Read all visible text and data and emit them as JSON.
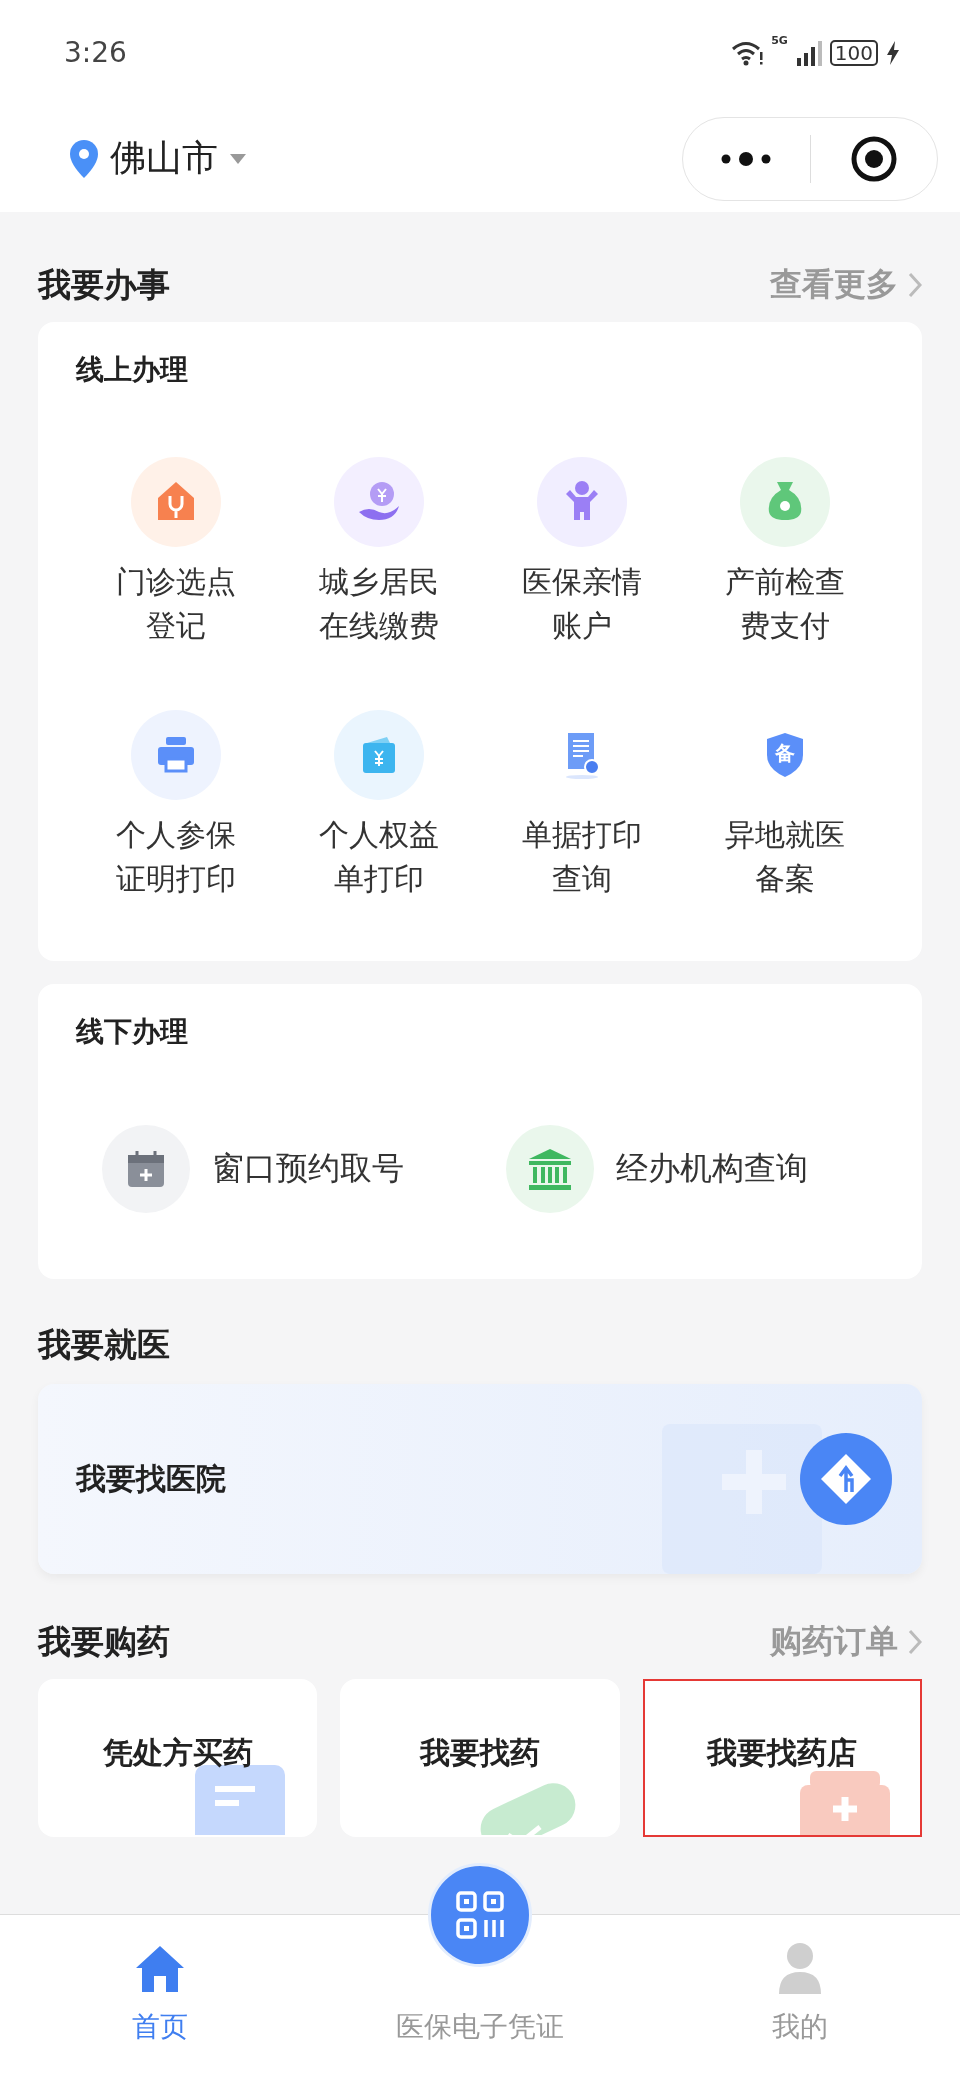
{
  "status_bar": {
    "time": "3:26",
    "network": "5G",
    "battery": "100"
  },
  "header": {
    "city": "佛山市"
  },
  "services": {
    "title": "我要办事",
    "more": "查看更多",
    "online": {
      "title": "线上办理",
      "items": [
        {
          "label": "门诊选点登记"
        },
        {
          "label": "城乡居民在线缴费"
        },
        {
          "label": "医保亲情账户"
        },
        {
          "label": "产前检查费支付"
        },
        {
          "label": "个人参保证明打印"
        },
        {
          "label": "个人权益单打印"
        },
        {
          "label": "单据打印查询"
        },
        {
          "label": "异地就医备案",
          "icon_text": "备"
        }
      ]
    },
    "offline": {
      "title": "线下办理",
      "items": [
        {
          "label": "窗口预约取号"
        },
        {
          "label": "经办机构查询"
        }
      ]
    }
  },
  "medical": {
    "title": "我要就医",
    "banner": "我要找医院"
  },
  "pharmacy": {
    "title": "我要购药",
    "more": "购药订单",
    "cards": [
      {
        "label": "凭处方买药",
        "selected": false
      },
      {
        "label": "我要找药",
        "selected": false
      },
      {
        "label": "我要找药店",
        "selected": true
      }
    ]
  },
  "tab_bar": [
    {
      "kind": "home",
      "label": "首页",
      "selected": true
    },
    {
      "kind": "scan",
      "label": "医保电子凭证",
      "selected": false
    },
    {
      "kind": "profile",
      "label": "我的",
      "selected": false
    }
  ]
}
